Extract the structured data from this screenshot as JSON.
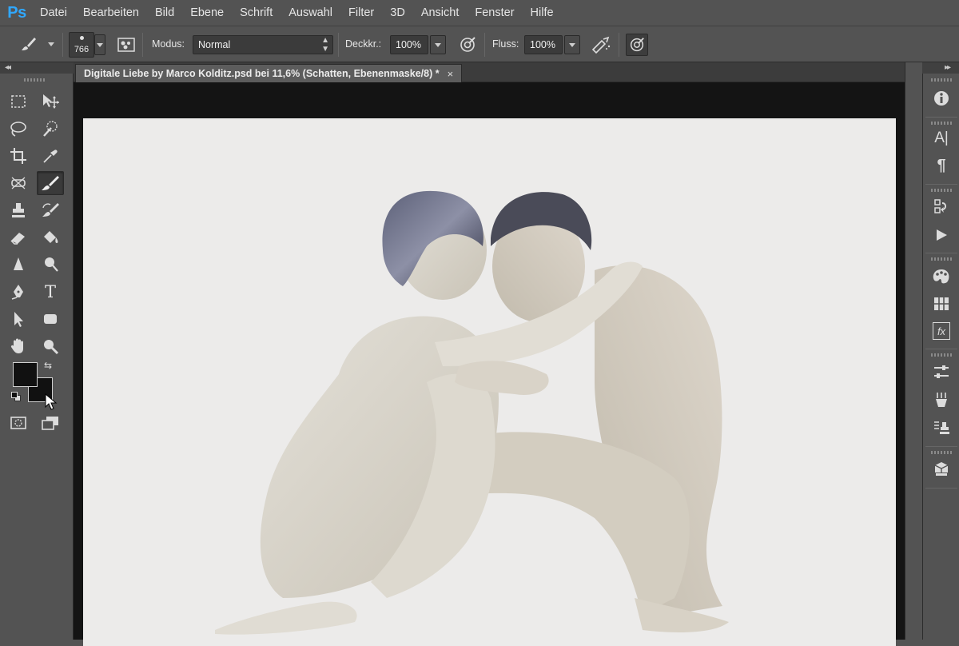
{
  "app": {
    "logo": "Ps",
    "logo_color": "#30a8ff"
  },
  "menu": [
    "Datei",
    "Bearbeiten",
    "Bild",
    "Ebene",
    "Schrift",
    "Auswahl",
    "Filter",
    "3D",
    "Ansicht",
    "Fenster",
    "Hilfe"
  ],
  "options": {
    "brush_size": "766",
    "mode_label": "Modus:",
    "mode_value": "Normal",
    "opacity_label": "Deckkr.:",
    "opacity_value": "100%",
    "flow_label": "Fluss:",
    "flow_value": "100%"
  },
  "document": {
    "tab_title": "Digitale Liebe by Marco Kolditz.psd bei 11,6% (Schatten, Ebenenmaske/8) *",
    "tab_close": "×"
  },
  "tools": {
    "type_tool_glyph": "T",
    "active_tool": "brush-tool",
    "foreground_color": "#111111",
    "background_color": "#111111"
  },
  "dock": {
    "character_glyph": "A|",
    "paragraph_glyph": "¶",
    "styles_glyph": "fx"
  },
  "colors": {
    "ui_gray": "#535353",
    "canvas_bg": "#141414",
    "artboard": "#ecebea"
  }
}
